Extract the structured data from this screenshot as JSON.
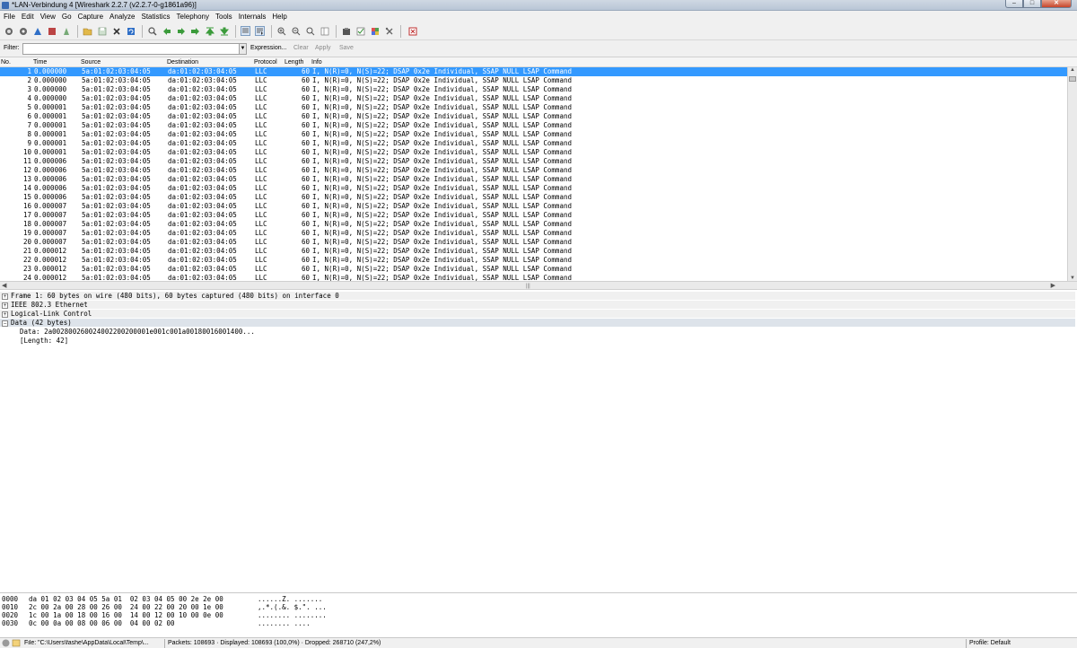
{
  "window": {
    "title": "*LAN-Verbindung 4 [Wireshark 2.2.7 (v2.2.7-0-g1861a96)]"
  },
  "menu": [
    "File",
    "Edit",
    "View",
    "Go",
    "Capture",
    "Analyze",
    "Statistics",
    "Telephony",
    "Tools",
    "Internals",
    "Help"
  ],
  "filter": {
    "label": "Filter:",
    "value": "",
    "expression": "Expression...",
    "clear": "Clear",
    "apply": "Apply",
    "save": "Save"
  },
  "columns": {
    "no": "No.",
    "time": "Time",
    "source": "Source",
    "destination": "Destination",
    "protocol": "Protocol",
    "length": "Length",
    "info": "Info"
  },
  "packets": [
    {
      "no": "1",
      "time": "0.000000",
      "src": "5a:01:02:03:04:05",
      "dst": "da:01:02:03:04:05",
      "proto": "LLC",
      "len": "60",
      "info": "I, N(R)=0, N(S)=22; DSAP 0x2e Individual, SSAP NULL LSAP Command"
    },
    {
      "no": "2",
      "time": "0.000000",
      "src": "5a:01:02:03:04:05",
      "dst": "da:01:02:03:04:05",
      "proto": "LLC",
      "len": "60",
      "info": "I, N(R)=0, N(S)=22; DSAP 0x2e Individual, SSAP NULL LSAP Command"
    },
    {
      "no": "3",
      "time": "0.000000",
      "src": "5a:01:02:03:04:05",
      "dst": "da:01:02:03:04:05",
      "proto": "LLC",
      "len": "60",
      "info": "I, N(R)=0, N(S)=22; DSAP 0x2e Individual, SSAP NULL LSAP Command"
    },
    {
      "no": "4",
      "time": "0.000000",
      "src": "5a:01:02:03:04:05",
      "dst": "da:01:02:03:04:05",
      "proto": "LLC",
      "len": "60",
      "info": "I, N(R)=0, N(S)=22; DSAP 0x2e Individual, SSAP NULL LSAP Command"
    },
    {
      "no": "5",
      "time": "0.000001",
      "src": "5a:01:02:03:04:05",
      "dst": "da:01:02:03:04:05",
      "proto": "LLC",
      "len": "60",
      "info": "I, N(R)=0, N(S)=22; DSAP 0x2e Individual, SSAP NULL LSAP Command"
    },
    {
      "no": "6",
      "time": "0.000001",
      "src": "5a:01:02:03:04:05",
      "dst": "da:01:02:03:04:05",
      "proto": "LLC",
      "len": "60",
      "info": "I, N(R)=0, N(S)=22; DSAP 0x2e Individual, SSAP NULL LSAP Command"
    },
    {
      "no": "7",
      "time": "0.000001",
      "src": "5a:01:02:03:04:05",
      "dst": "da:01:02:03:04:05",
      "proto": "LLC",
      "len": "60",
      "info": "I, N(R)=0, N(S)=22; DSAP 0x2e Individual, SSAP NULL LSAP Command"
    },
    {
      "no": "8",
      "time": "0.000001",
      "src": "5a:01:02:03:04:05",
      "dst": "da:01:02:03:04:05",
      "proto": "LLC",
      "len": "60",
      "info": "I, N(R)=0, N(S)=22; DSAP 0x2e Individual, SSAP NULL LSAP Command"
    },
    {
      "no": "9",
      "time": "0.000001",
      "src": "5a:01:02:03:04:05",
      "dst": "da:01:02:03:04:05",
      "proto": "LLC",
      "len": "60",
      "info": "I, N(R)=0, N(S)=22; DSAP 0x2e Individual, SSAP NULL LSAP Command"
    },
    {
      "no": "10",
      "time": "0.000001",
      "src": "5a:01:02:03:04:05",
      "dst": "da:01:02:03:04:05",
      "proto": "LLC",
      "len": "60",
      "info": "I, N(R)=0, N(S)=22; DSAP 0x2e Individual, SSAP NULL LSAP Command"
    },
    {
      "no": "11",
      "time": "0.000006",
      "src": "5a:01:02:03:04:05",
      "dst": "da:01:02:03:04:05",
      "proto": "LLC",
      "len": "60",
      "info": "I, N(R)=0, N(S)=22; DSAP 0x2e Individual, SSAP NULL LSAP Command"
    },
    {
      "no": "12",
      "time": "0.000006",
      "src": "5a:01:02:03:04:05",
      "dst": "da:01:02:03:04:05",
      "proto": "LLC",
      "len": "60",
      "info": "I, N(R)=0, N(S)=22; DSAP 0x2e Individual, SSAP NULL LSAP Command"
    },
    {
      "no": "13",
      "time": "0.000006",
      "src": "5a:01:02:03:04:05",
      "dst": "da:01:02:03:04:05",
      "proto": "LLC",
      "len": "60",
      "info": "I, N(R)=0, N(S)=22; DSAP 0x2e Individual, SSAP NULL LSAP Command"
    },
    {
      "no": "14",
      "time": "0.000006",
      "src": "5a:01:02:03:04:05",
      "dst": "da:01:02:03:04:05",
      "proto": "LLC",
      "len": "60",
      "info": "I, N(R)=0, N(S)=22; DSAP 0x2e Individual, SSAP NULL LSAP Command"
    },
    {
      "no": "15",
      "time": "0.000006",
      "src": "5a:01:02:03:04:05",
      "dst": "da:01:02:03:04:05",
      "proto": "LLC",
      "len": "60",
      "info": "I, N(R)=0, N(S)=22; DSAP 0x2e Individual, SSAP NULL LSAP Command"
    },
    {
      "no": "16",
      "time": "0.000007",
      "src": "5a:01:02:03:04:05",
      "dst": "da:01:02:03:04:05",
      "proto": "LLC",
      "len": "60",
      "info": "I, N(R)=0, N(S)=22; DSAP 0x2e Individual, SSAP NULL LSAP Command"
    },
    {
      "no": "17",
      "time": "0.000007",
      "src": "5a:01:02:03:04:05",
      "dst": "da:01:02:03:04:05",
      "proto": "LLC",
      "len": "60",
      "info": "I, N(R)=0, N(S)=22; DSAP 0x2e Individual, SSAP NULL LSAP Command"
    },
    {
      "no": "18",
      "time": "0.000007",
      "src": "5a:01:02:03:04:05",
      "dst": "da:01:02:03:04:05",
      "proto": "LLC",
      "len": "60",
      "info": "I, N(R)=0, N(S)=22; DSAP 0x2e Individual, SSAP NULL LSAP Command"
    },
    {
      "no": "19",
      "time": "0.000007",
      "src": "5a:01:02:03:04:05",
      "dst": "da:01:02:03:04:05",
      "proto": "LLC",
      "len": "60",
      "info": "I, N(R)=0, N(S)=22; DSAP 0x2e Individual, SSAP NULL LSAP Command"
    },
    {
      "no": "20",
      "time": "0.000007",
      "src": "5a:01:02:03:04:05",
      "dst": "da:01:02:03:04:05",
      "proto": "LLC",
      "len": "60",
      "info": "I, N(R)=0, N(S)=22; DSAP 0x2e Individual, SSAP NULL LSAP Command"
    },
    {
      "no": "21",
      "time": "0.000012",
      "src": "5a:01:02:03:04:05",
      "dst": "da:01:02:03:04:05",
      "proto": "LLC",
      "len": "60",
      "info": "I, N(R)=0, N(S)=22; DSAP 0x2e Individual, SSAP NULL LSAP Command"
    },
    {
      "no": "22",
      "time": "0.000012",
      "src": "5a:01:02:03:04:05",
      "dst": "da:01:02:03:04:05",
      "proto": "LLC",
      "len": "60",
      "info": "I, N(R)=0, N(S)=22; DSAP 0x2e Individual, SSAP NULL LSAP Command"
    },
    {
      "no": "23",
      "time": "0.000012",
      "src": "5a:01:02:03:04:05",
      "dst": "da:01:02:03:04:05",
      "proto": "LLC",
      "len": "60",
      "info": "I, N(R)=0, N(S)=22; DSAP 0x2e Individual, SSAP NULL LSAP Command"
    },
    {
      "no": "24",
      "time": "0.000012",
      "src": "5a:01:02:03:04:05",
      "dst": "da:01:02:03:04:05",
      "proto": "LLC",
      "len": "60",
      "info": "I, N(R)=0, N(S)=22; DSAP 0x2e Individual, SSAP NULL LSAP Command"
    }
  ],
  "details": {
    "frame": "Frame 1: 60 bytes on wire (480 bits), 60 bytes captured (480 bits) on interface 0",
    "ethernet": "IEEE 802.3 Ethernet",
    "llc": "Logical-Link Control",
    "data": "Data (42 bytes)",
    "data_value": "Data: 2a002800260024002200200001e001c001a00180016001400...",
    "data_length": "[Length: 42]"
  },
  "bytes": [
    {
      "offset": "0000",
      "hex": "da 01 02 03 04 05 5a 01  02 03 04 05 00 2e 2e 00",
      "ascii": "......Z. ......."
    },
    {
      "offset": "0010",
      "hex": "2c 00 2a 00 28 00 26 00  24 00 22 00 20 00 1e 00",
      "ascii": ",.*.(.&. $.\". ..."
    },
    {
      "offset": "0020",
      "hex": "1c 00 1a 00 18 00 16 00  14 00 12 00 10 00 0e 00",
      "ascii": "........ ........"
    },
    {
      "offset": "0030",
      "hex": "0c 00 0a 00 08 00 06 00  04 00 02 00",
      "ascii": "........ ...."
    }
  ],
  "status": {
    "file": "File: \"C:\\Users\\fashe\\AppData\\Local\\Temp\\...",
    "packets": "Packets: 108693 · Displayed: 108693 (100,0%) · Dropped: 268710 (247,2%)",
    "profile": "Profile: Default"
  },
  "colors": {
    "selection": "#3399ff",
    "window_bg": "#f0f0f0"
  }
}
